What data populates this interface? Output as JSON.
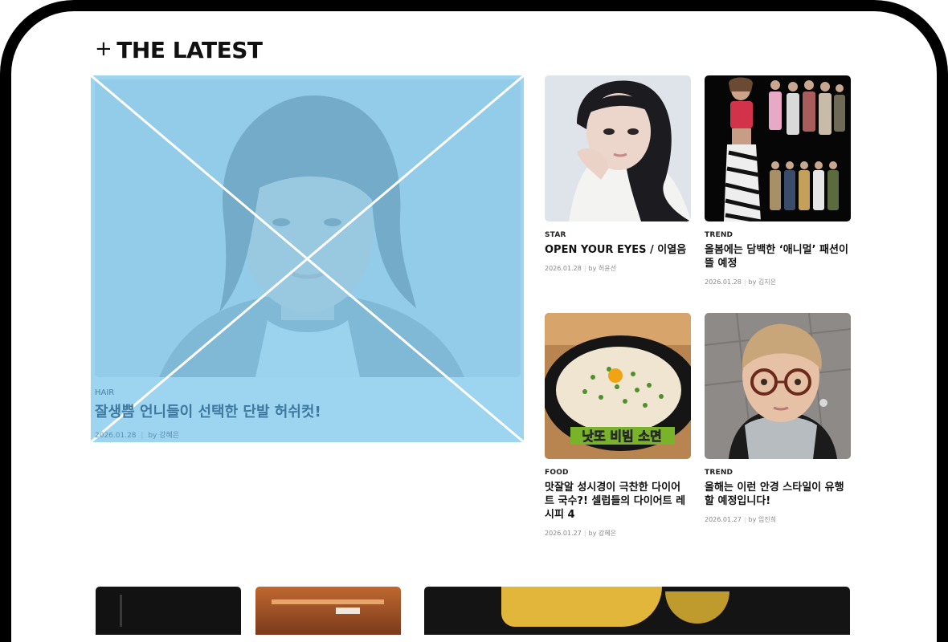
{
  "section": {
    "title": "THE LATEST",
    "icon": "plus-icon"
  },
  "featured": {
    "category": "HAIR",
    "title": "잘생쁨 언니들이 선택한 단발 허쉬컷!",
    "date": "2026.01.28",
    "author": "by 강혜은",
    "overlay_color": "#87CBED"
  },
  "cards": [
    {
      "category": "STAR",
      "title": "OPEN YOUR EYES / 이열음",
      "date": "2026.01.28",
      "author": "by 허윤선"
    },
    {
      "category": "TREND",
      "title": "올봄에는 담백한 ‘애니멀’ 패션이 뜰 예정",
      "date": "2026.01.28",
      "author": "by 김지은"
    },
    {
      "category": "FOOD",
      "title": "맛잘알 성시경이 극찬한 다이어트 국수?! 셀럽들의 다이어트 레시피 4",
      "date": "2026.01.27",
      "author": "by 강혜은"
    },
    {
      "category": "TREND",
      "title": "올해는 이런 안경 스타일이 유행할 예정입니다!",
      "date": "2026.01.27",
      "author": "by 임진희"
    }
  ],
  "food_caption": "낫또 비빔 소면"
}
